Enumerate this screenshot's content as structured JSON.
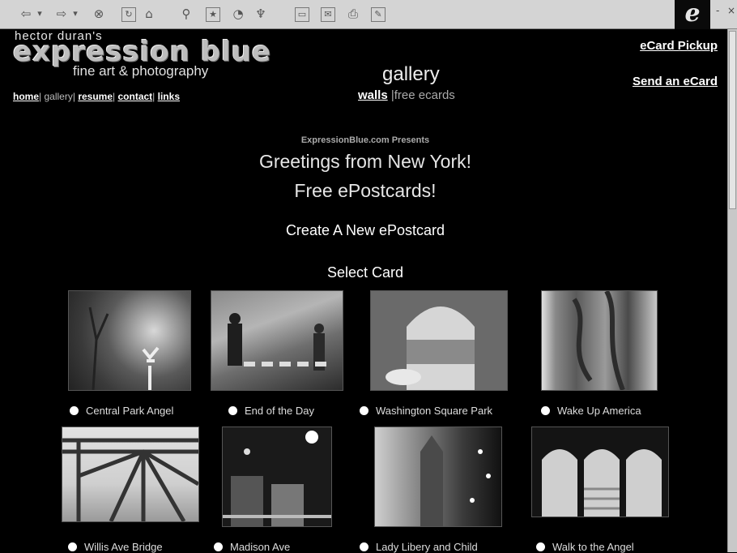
{
  "toolbar": {
    "icons": [
      "back-icon",
      "dropdown-icon",
      "forward-icon",
      "dropdown-icon",
      "stop-icon",
      "refresh-icon",
      "home-icon",
      "search-icon",
      "favorites-icon",
      "history-icon",
      "channels-icon",
      "fullscreen-icon",
      "mail-icon",
      "print-icon",
      "edit-icon"
    ],
    "window_controls": [
      "-",
      "×"
    ]
  },
  "site": {
    "logo_small": "hector  duran's",
    "logo_big": "expression blue",
    "logo_sub": "fine art & photography"
  },
  "nav": {
    "home": "home",
    "gallery": "gallery",
    "resume": "resume",
    "contact": "contact",
    "links": "links",
    "sep": "|"
  },
  "section": {
    "title": "gallery",
    "walls": "walls",
    "free_ecards": "free ecards",
    "sep": "|"
  },
  "right_links": {
    "pickup": "eCard Pickup",
    "send": "Send an eCard"
  },
  "main": {
    "presents": "ExpressionBlue.com Presents",
    "headline1": "Greetings from New York!",
    "headline2": "Free ePostcards!",
    "create": "Create A New ePostcard",
    "select": "Select Card"
  },
  "cards": [
    {
      "label": "Central Park Angel"
    },
    {
      "label": "End of the Day"
    },
    {
      "label": "Washington Square Park"
    },
    {
      "label": "Wake Up America"
    },
    {
      "label": "Willis Ave Bridge"
    },
    {
      "label": "Madison Ave"
    },
    {
      "label": "Lady Libery and Child"
    },
    {
      "label": "Walk to the Angel"
    }
  ]
}
